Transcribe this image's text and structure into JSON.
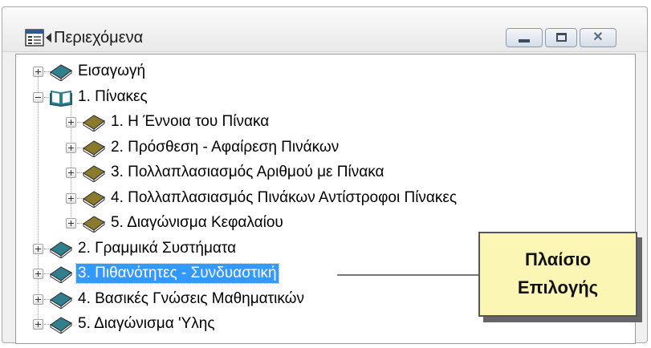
{
  "window": {
    "title": "Περιεχόμενα",
    "close_glyph": "✕",
    "icons": {
      "app": "contents-window-icon",
      "minimize": "minimize-icon",
      "maximize": "maximize-icon",
      "close": "close-icon"
    }
  },
  "tree": {
    "items": [
      {
        "label": "Εισαγωγή",
        "level": 0,
        "expander": "plus",
        "icon": "closed-book-icon",
        "icon_color": "#2f7f8f"
      },
      {
        "label": "1.  Πίνακες",
        "level": 0,
        "expander": "minus",
        "icon": "open-book-icon",
        "icon_color": "#2f7f8f"
      },
      {
        "label": "1.  Η Έννοια του Πίνακα",
        "level": 1,
        "expander": "plus",
        "icon": "closed-book-icon",
        "icon_color": "#8a7a2c"
      },
      {
        "label": "2.  Πρόσθεση - Αφαίρεση Πινάκων",
        "level": 1,
        "expander": "plus",
        "icon": "closed-book-icon",
        "icon_color": "#8a7a2c"
      },
      {
        "label": "3.  Πολλαπλασιασμός Αριθμού με Πίνακα",
        "level": 1,
        "expander": "plus",
        "icon": "closed-book-icon",
        "icon_color": "#8a7a2c"
      },
      {
        "label": "4.  Πολλαπλασιασμός Πινάκων Αντίστροφοι Πίνακες",
        "level": 1,
        "expander": "plus",
        "icon": "closed-book-icon",
        "icon_color": "#8a7a2c"
      },
      {
        "label": "5.  Διαγώνισμα Κεφαλαίου",
        "level": 1,
        "expander": "plus",
        "icon": "closed-book-icon",
        "icon_color": "#8a7a2c"
      },
      {
        "label": "2.  Γραμμικά Συστήματα",
        "level": 0,
        "expander": "plus",
        "icon": "closed-book-icon",
        "icon_color": "#2f7f8f"
      },
      {
        "label": "3.  Πιθανότητες - Συνδυαστική",
        "level": 0,
        "expander": "plus",
        "icon": "closed-book-icon",
        "icon_color": "#2f7f8f",
        "selected": true
      },
      {
        "label": "4.  Βασικές Γνώσεις Μαθηματικών",
        "level": 0,
        "expander": "plus",
        "icon": "closed-book-icon",
        "icon_color": "#2f7f8f"
      },
      {
        "label": "5.  Διαγώνισμα 'Υλης",
        "level": 0,
        "expander": "plus",
        "icon": "closed-book-icon",
        "icon_color": "#2f7f8f"
      }
    ]
  },
  "callout": {
    "line1": "Πλαίσιο",
    "line2": "Επιλογής",
    "background": "#fbf6b3"
  },
  "colors": {
    "selection": "#3399ff",
    "selection_text": "#ffffff"
  }
}
